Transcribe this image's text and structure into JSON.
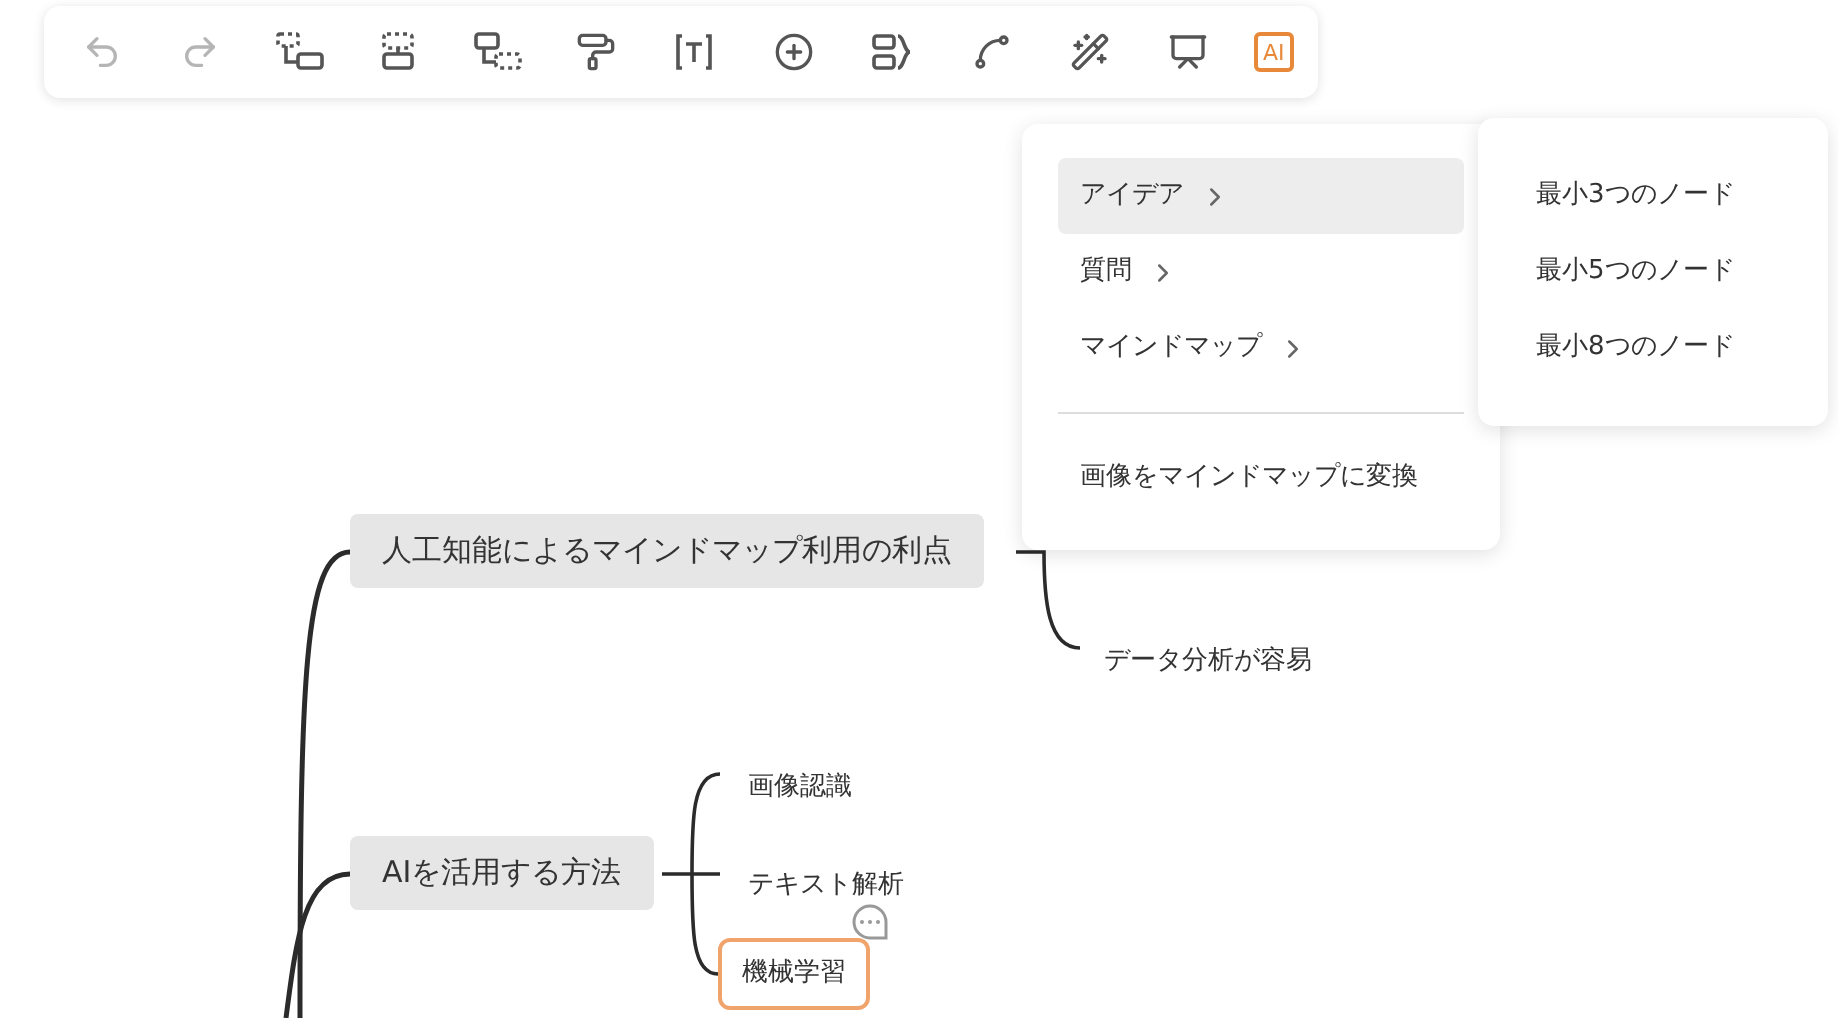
{
  "toolbar": {
    "tools": [
      {
        "kind": "undo",
        "disabled": true
      },
      {
        "kind": "redo",
        "disabled": true
      },
      {
        "kind": "child",
        "disabled": false
      },
      {
        "kind": "sibling",
        "disabled": false
      },
      {
        "kind": "parent",
        "disabled": false
      },
      {
        "kind": "format",
        "disabled": false
      },
      {
        "kind": "text",
        "disabled": false
      },
      {
        "kind": "insert",
        "disabled": false
      },
      {
        "kind": "summary",
        "disabled": false
      },
      {
        "kind": "relation",
        "disabled": false
      },
      {
        "kind": "magic",
        "disabled": false
      },
      {
        "kind": "present",
        "disabled": false
      },
      {
        "kind": "ai",
        "disabled": false,
        "label": "AI",
        "selected": true
      }
    ]
  },
  "menu": {
    "items": [
      {
        "label": "アイデア",
        "has_submenu": true,
        "selected": true
      },
      {
        "label": "質問",
        "has_submenu": true,
        "selected": false
      },
      {
        "label": "マインドマップ",
        "has_submenu": true,
        "selected": false
      },
      {
        "label": "画像をマインドマップに変換",
        "has_submenu": false,
        "selected": false
      }
    ],
    "submenu": {
      "items": [
        {
          "label": "最小3つのノード"
        },
        {
          "label": "最小5つのノード"
        },
        {
          "label": "最小8つのノード"
        }
      ]
    }
  },
  "mindmap": {
    "topics": [
      {
        "label": "人工知能によるマインドマップ利用の利点",
        "children": [
          {
            "label": "データ分析が容易",
            "selected": false,
            "has_comment": false
          }
        ]
      },
      {
        "label": "AIを活用する方法",
        "children": [
          {
            "label": "画像認識",
            "selected": false,
            "has_comment": false
          },
          {
            "label": "テキスト解析",
            "selected": false,
            "has_comment": false
          },
          {
            "label": "機械学習",
            "selected": true,
            "has_comment": true
          }
        ]
      }
    ]
  }
}
